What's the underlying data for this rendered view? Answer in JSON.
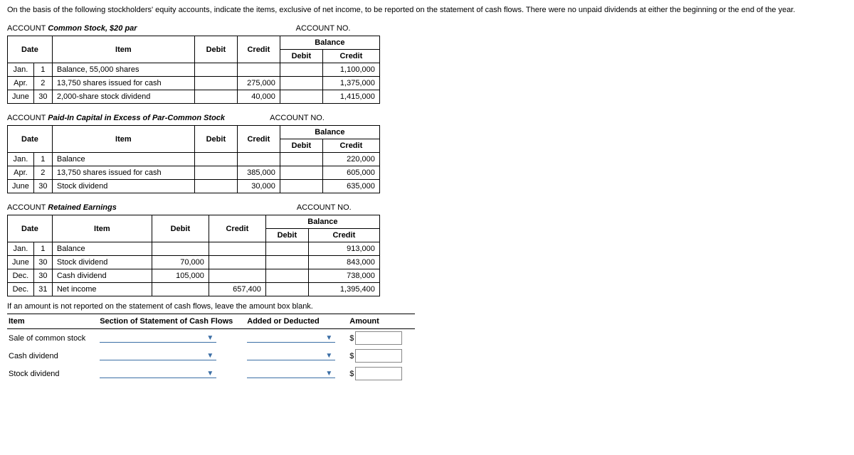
{
  "instruction": "On the basis of the following stockholders' equity accounts, indicate the items, exclusive of net income, to be reported on the statement of cash flows. There were no unpaid dividends at either the beginning or the end of the year.",
  "labels": {
    "account": "ACCOUNT",
    "accountNo": "ACCOUNT NO.",
    "date": "Date",
    "item": "Item",
    "debit": "Debit",
    "credit": "Credit",
    "balance": "Balance"
  },
  "ledgers": [
    {
      "name": "Common Stock, $20 par",
      "rows": [
        {
          "month": "Jan.",
          "day": "1",
          "item": "Balance, 55,000 shares",
          "debit": "",
          "credit": "",
          "bdebit": "",
          "bcredit": "1,100,000"
        },
        {
          "month": "Apr.",
          "day": "2",
          "item": "13,750 shares issued for cash",
          "debit": "",
          "credit": "275,000",
          "bdebit": "",
          "bcredit": "1,375,000"
        },
        {
          "month": "June",
          "day": "30",
          "item": "2,000-share stock dividend",
          "debit": "",
          "credit": "40,000",
          "bdebit": "",
          "bcredit": "1,415,000"
        }
      ]
    },
    {
      "name": "Paid-In Capital in Excess of Par-Common Stock",
      "rows": [
        {
          "month": "Jan.",
          "day": "1",
          "item": "Balance",
          "debit": "",
          "credit": "",
          "bdebit": "",
          "bcredit": "220,000"
        },
        {
          "month": "Apr.",
          "day": "2",
          "item": "13,750 shares issued for cash",
          "debit": "",
          "credit": "385,000",
          "bdebit": "",
          "bcredit": "605,000"
        },
        {
          "month": "June",
          "day": "30",
          "item": "Stock dividend",
          "debit": "",
          "credit": "30,000",
          "bdebit": "",
          "bcredit": "635,000"
        }
      ]
    },
    {
      "name": "Retained Earnings",
      "rows": [
        {
          "month": "Jan.",
          "day": "1",
          "item": "Balance",
          "debit": "",
          "credit": "",
          "bdebit": "",
          "bcredit": "913,000"
        },
        {
          "month": "June",
          "day": "30",
          "item": "Stock dividend",
          "debit": "70,000",
          "credit": "",
          "bdebit": "",
          "bcredit": "843,000"
        },
        {
          "month": "Dec.",
          "day": "30",
          "item": "Cash dividend",
          "debit": "105,000",
          "credit": "",
          "bdebit": "",
          "bcredit": "738,000"
        },
        {
          "month": "Dec.",
          "day": "31",
          "item": "Net income",
          "debit": "",
          "credit": "657,400",
          "bdebit": "",
          "bcredit": "1,395,400"
        }
      ]
    }
  ],
  "note": "If an amount is not reported on the statement of cash flows, leave the amount box blank.",
  "answer": {
    "headers": {
      "item": "Item",
      "section": "Section of Statement of Cash Flows",
      "added": "Added or Deducted",
      "amount": "Amount"
    },
    "rows": [
      {
        "item": "Sale of common stock"
      },
      {
        "item": "Cash dividend"
      },
      {
        "item": "Stock dividend"
      }
    ],
    "dollar": "$"
  }
}
